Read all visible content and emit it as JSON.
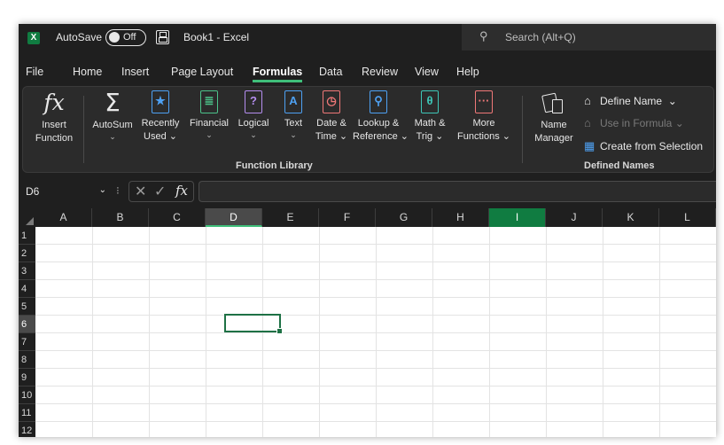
{
  "titlebar": {
    "app_icon": "excel-logo-icon",
    "autosave_label": "AutoSave",
    "autosave_state": "Off",
    "save_icon": "save-icon",
    "document_title": "Book1 - Excel",
    "search_placeholder": "Search (Alt+Q)"
  },
  "tabs": [
    {
      "label": "File"
    },
    {
      "label": "Home"
    },
    {
      "label": "Insert"
    },
    {
      "label": "Page Layout"
    },
    {
      "label": "Formulas",
      "active": true
    },
    {
      "label": "Data"
    },
    {
      "label": "Review"
    },
    {
      "label": "View"
    },
    {
      "label": "Help"
    }
  ],
  "ribbon": {
    "insert_function": {
      "line1": "Insert",
      "line2": "Function"
    },
    "autosum": {
      "label": "AutoSum",
      "caret": "⌄"
    },
    "recently_used": {
      "line1": "Recently",
      "line2": "Used ⌄"
    },
    "financial": {
      "label": "Financial",
      "caret": "⌄"
    },
    "logical": {
      "label": "Logical",
      "caret": "⌄"
    },
    "text": {
      "label": "Text",
      "caret": "⌄"
    },
    "date_time": {
      "line1": "Date &",
      "line2": "Time ⌄"
    },
    "lookup_reference": {
      "line1": "Lookup &",
      "line2": "Reference ⌄"
    },
    "math_trig": {
      "line1": "Math &",
      "line2": "Trig ⌄"
    },
    "more_functions": {
      "line1": "More",
      "line2": "Functions ⌄"
    },
    "function_library_label": "Function Library",
    "name_manager": {
      "line1": "Name",
      "line2": "Manager"
    },
    "define_name": "Define Name",
    "define_name_caret": "⌄",
    "use_in_formula": "Use in Formula ⌄",
    "create_from_selection": "Create from Selection",
    "defined_names_label": "Defined Names"
  },
  "formula_bar": {
    "name_box": "D6",
    "name_box_caret": "⌄",
    "separator": "⁝",
    "cancel_glyph": "✕",
    "enter_glyph": "✓",
    "fx_glyph": "fx",
    "formula_value": ""
  },
  "grid": {
    "columns": [
      "A",
      "B",
      "C",
      "D",
      "E",
      "F",
      "G",
      "H",
      "I",
      "J",
      "K",
      "L"
    ],
    "selected_column": "D",
    "highlighted_column": "I",
    "rows": [
      "1",
      "2",
      "3",
      "4",
      "5",
      "6",
      "7",
      "8",
      "9",
      "10",
      "11",
      "12"
    ],
    "selected_row": "6",
    "active_cell": "D6"
  },
  "colors": {
    "accent_green": "#107c41",
    "selection_border": "#1e7145",
    "ribbon_bg": "#2b2b2b",
    "chrome_bg": "#1f1f1f"
  }
}
